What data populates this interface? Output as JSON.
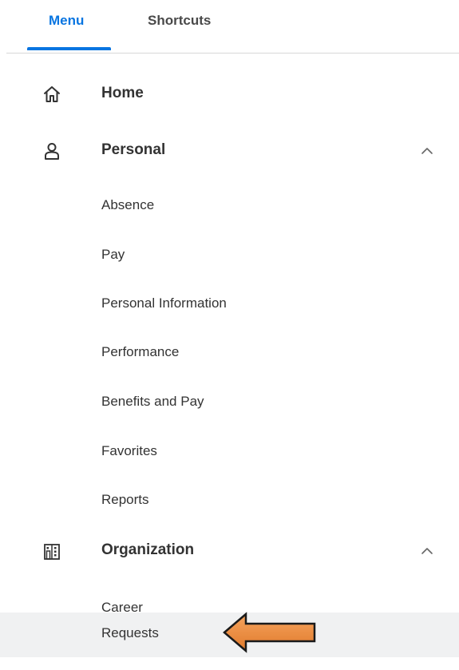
{
  "tabs": [
    {
      "label": "Menu",
      "active": true
    },
    {
      "label": "Shortcuts",
      "active": false
    }
  ],
  "accent_color": "#0875e1",
  "menu": {
    "home": {
      "label": "Home",
      "icon": "home-icon"
    },
    "personal": {
      "label": "Personal",
      "icon": "person-icon",
      "expanded": true,
      "items": [
        {
          "label": "Absence"
        },
        {
          "label": "Pay"
        },
        {
          "label": "Personal Information"
        },
        {
          "label": "Performance"
        },
        {
          "label": "Benefits and Pay"
        },
        {
          "label": "Favorites"
        },
        {
          "label": "Reports"
        }
      ]
    },
    "organization": {
      "label": "Organization",
      "icon": "building-icon",
      "expanded": true,
      "items": [
        {
          "label": "Career"
        },
        {
          "label": "Requests",
          "highlighted": true
        }
      ]
    }
  },
  "annotation": {
    "type": "arrow",
    "direction": "left",
    "color": "#f08c3c",
    "points_to": "Requests"
  }
}
